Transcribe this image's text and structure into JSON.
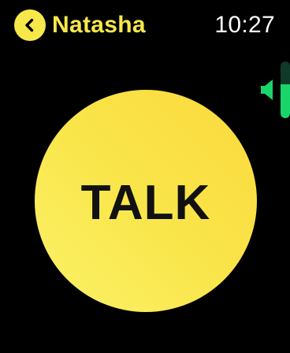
{
  "header": {
    "back_icon": "chevron-left-icon",
    "contact_name": "Natasha",
    "time": "10:27"
  },
  "volume": {
    "icon": "speaker-icon",
    "level": 0.6,
    "fill_color": "#19d66b",
    "track_color": "#0f3a2a"
  },
  "talk": {
    "label": "TALK",
    "color": "#f9e54a"
  },
  "colors": {
    "accent": "#f7e84a",
    "background": "#000000"
  }
}
